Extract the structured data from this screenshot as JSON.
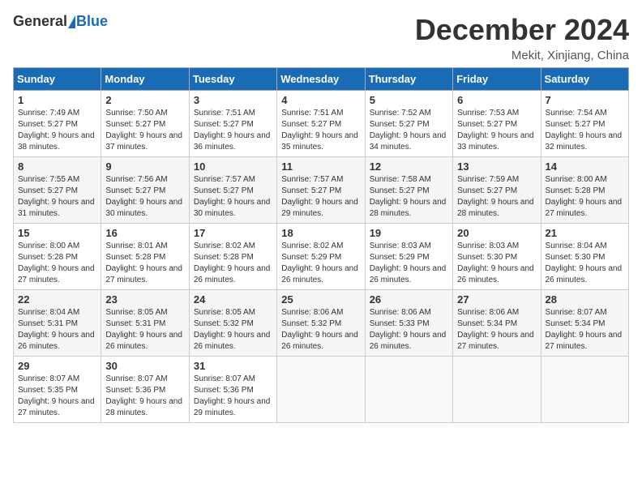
{
  "header": {
    "logo_general": "General",
    "logo_blue": "Blue",
    "month": "December 2024",
    "location": "Mekit, Xinjiang, China"
  },
  "weekdays": [
    "Sunday",
    "Monday",
    "Tuesday",
    "Wednesday",
    "Thursday",
    "Friday",
    "Saturday"
  ],
  "weeks": [
    [
      {
        "day": "1",
        "sunrise": "7:49 AM",
        "sunset": "5:27 PM",
        "daylight": "9 hours and 38 minutes."
      },
      {
        "day": "2",
        "sunrise": "7:50 AM",
        "sunset": "5:27 PM",
        "daylight": "9 hours and 37 minutes."
      },
      {
        "day": "3",
        "sunrise": "7:51 AM",
        "sunset": "5:27 PM",
        "daylight": "9 hours and 36 minutes."
      },
      {
        "day": "4",
        "sunrise": "7:51 AM",
        "sunset": "5:27 PM",
        "daylight": "9 hours and 35 minutes."
      },
      {
        "day": "5",
        "sunrise": "7:52 AM",
        "sunset": "5:27 PM",
        "daylight": "9 hours and 34 minutes."
      },
      {
        "day": "6",
        "sunrise": "7:53 AM",
        "sunset": "5:27 PM",
        "daylight": "9 hours and 33 minutes."
      },
      {
        "day": "7",
        "sunrise": "7:54 AM",
        "sunset": "5:27 PM",
        "daylight": "9 hours and 32 minutes."
      }
    ],
    [
      {
        "day": "8",
        "sunrise": "7:55 AM",
        "sunset": "5:27 PM",
        "daylight": "9 hours and 31 minutes."
      },
      {
        "day": "9",
        "sunrise": "7:56 AM",
        "sunset": "5:27 PM",
        "daylight": "9 hours and 30 minutes."
      },
      {
        "day": "10",
        "sunrise": "7:57 AM",
        "sunset": "5:27 PM",
        "daylight": "9 hours and 30 minutes."
      },
      {
        "day": "11",
        "sunrise": "7:57 AM",
        "sunset": "5:27 PM",
        "daylight": "9 hours and 29 minutes."
      },
      {
        "day": "12",
        "sunrise": "7:58 AM",
        "sunset": "5:27 PM",
        "daylight": "9 hours and 28 minutes."
      },
      {
        "day": "13",
        "sunrise": "7:59 AM",
        "sunset": "5:27 PM",
        "daylight": "9 hours and 28 minutes."
      },
      {
        "day": "14",
        "sunrise": "8:00 AM",
        "sunset": "5:28 PM",
        "daylight": "9 hours and 27 minutes."
      }
    ],
    [
      {
        "day": "15",
        "sunrise": "8:00 AM",
        "sunset": "5:28 PM",
        "daylight": "9 hours and 27 minutes."
      },
      {
        "day": "16",
        "sunrise": "8:01 AM",
        "sunset": "5:28 PM",
        "daylight": "9 hours and 27 minutes."
      },
      {
        "day": "17",
        "sunrise": "8:02 AM",
        "sunset": "5:28 PM",
        "daylight": "9 hours and 26 minutes."
      },
      {
        "day": "18",
        "sunrise": "8:02 AM",
        "sunset": "5:29 PM",
        "daylight": "9 hours and 26 minutes."
      },
      {
        "day": "19",
        "sunrise": "8:03 AM",
        "sunset": "5:29 PM",
        "daylight": "9 hours and 26 minutes."
      },
      {
        "day": "20",
        "sunrise": "8:03 AM",
        "sunset": "5:30 PM",
        "daylight": "9 hours and 26 minutes."
      },
      {
        "day": "21",
        "sunrise": "8:04 AM",
        "sunset": "5:30 PM",
        "daylight": "9 hours and 26 minutes."
      }
    ],
    [
      {
        "day": "22",
        "sunrise": "8:04 AM",
        "sunset": "5:31 PM",
        "daylight": "9 hours and 26 minutes."
      },
      {
        "day": "23",
        "sunrise": "8:05 AM",
        "sunset": "5:31 PM",
        "daylight": "9 hours and 26 minutes."
      },
      {
        "day": "24",
        "sunrise": "8:05 AM",
        "sunset": "5:32 PM",
        "daylight": "9 hours and 26 minutes."
      },
      {
        "day": "25",
        "sunrise": "8:06 AM",
        "sunset": "5:32 PM",
        "daylight": "9 hours and 26 minutes."
      },
      {
        "day": "26",
        "sunrise": "8:06 AM",
        "sunset": "5:33 PM",
        "daylight": "9 hours and 26 minutes."
      },
      {
        "day": "27",
        "sunrise": "8:06 AM",
        "sunset": "5:34 PM",
        "daylight": "9 hours and 27 minutes."
      },
      {
        "day": "28",
        "sunrise": "8:07 AM",
        "sunset": "5:34 PM",
        "daylight": "9 hours and 27 minutes."
      }
    ],
    [
      {
        "day": "29",
        "sunrise": "8:07 AM",
        "sunset": "5:35 PM",
        "daylight": "9 hours and 27 minutes."
      },
      {
        "day": "30",
        "sunrise": "8:07 AM",
        "sunset": "5:36 PM",
        "daylight": "9 hours and 28 minutes."
      },
      {
        "day": "31",
        "sunrise": "8:07 AM",
        "sunset": "5:36 PM",
        "daylight": "9 hours and 29 minutes."
      },
      null,
      null,
      null,
      null
    ]
  ]
}
